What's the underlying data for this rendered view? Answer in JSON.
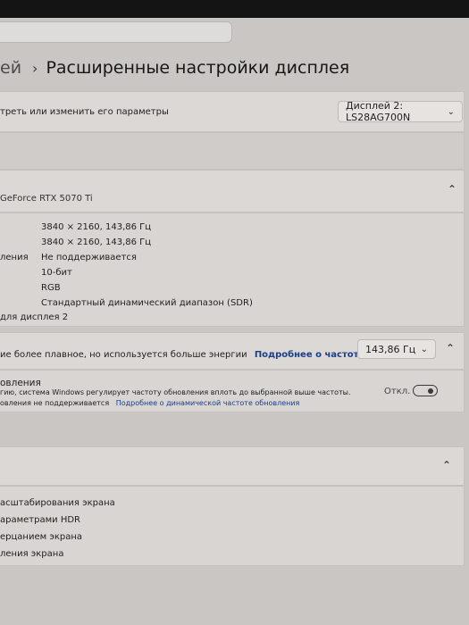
{
  "breadcrumb": {
    "previous": "ей",
    "separator": "›",
    "current": "Расширенные настройки дисплея"
  },
  "select_display": {
    "label": "треть или изменить его параметры",
    "value": "Дисплей 2: LS28AG700N"
  },
  "display_info": {
    "gpu": "GeForce RTX 5070 Ti",
    "values": [
      "3840 × 2160, 143,86 Гц",
      "3840 × 2160, 143,86 Гц",
      "Не поддерживается",
      "10-бит",
      "RGB",
      "Стандартный динамический диапазон (SDR)"
    ],
    "partial_labels": {
      "row3": "ления",
      "footer": "для дисплея 2"
    }
  },
  "refresh_rate": {
    "description": "ие более плавное, но используется больше энергии",
    "link": "Подробнее о частоте обновления",
    "value": "143,86 Гц"
  },
  "dynamic_refresh": {
    "title": "овления",
    "description": "гию, система Windows регулирует частоту обновления вплоть до выбранной выше частоты.",
    "not_supported": "овления не поддерживается",
    "link": "Подробнее о динамической частоте обновления",
    "toggle_label": "Откл.",
    "toggle_state": "off"
  },
  "related": {
    "links": [
      "асштабирования экрана",
      "араметрами HDR",
      "ерцанием экрана",
      "ления экрана"
    ]
  },
  "icons": {
    "chevron_up": "⌃",
    "chevron_down": "⌄"
  },
  "colors": {
    "accent_link": "#1b3f86",
    "page_bg": "#c9c6c4",
    "card_bg": "#dbd8d6"
  }
}
